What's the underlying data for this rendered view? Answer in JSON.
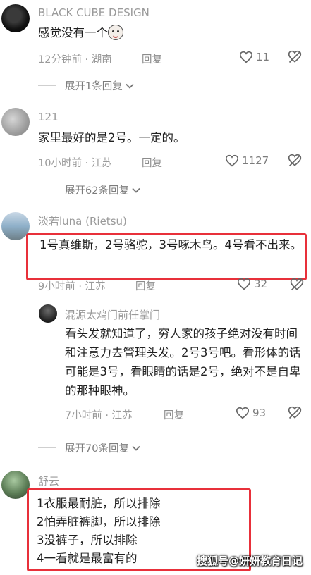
{
  "comments": [
    {
      "username": "BLACK CUBE DESIGN",
      "text": "感觉没有一个",
      "emoji_icon": "cat-face-icon",
      "meta": "12分钟前 · 湖南",
      "reply_label": "回复",
      "likes": "11",
      "expand": "展开1条回复"
    },
    {
      "username": "121",
      "text": "家里最好的是2号。一定的。",
      "meta": "10小时前 · 江苏",
      "reply_label": "回复",
      "likes": "1127",
      "expand": "展开62条回复"
    },
    {
      "username": "淡若luna (Rietsu)",
      "text": "1号真维斯，2号骆驼，3号啄木鸟。4号看不出来。",
      "meta": "9小时前 · 江苏",
      "reply_label": "回复",
      "likes": "32",
      "reply": {
        "username": "混源太鸡门前任掌门",
        "text": "看头发就知道了，穷人家的孩子绝对没有时间和注意力去管理头发。2号3号吧。看形体的话可能是3号，看眼睛的话是2号，绝对不是自卑的那种眼神。",
        "meta": "7小时前 · 江苏",
        "reply_label": "回复",
        "likes": "93"
      },
      "expand": "展开70条回复"
    },
    {
      "username": "舒云",
      "lines": [
        "1衣服最耐脏，所以排除",
        "2怕弄脏裤脚，所以排除",
        "3没裤子，所以排除",
        "4一看就是最富有的"
      ]
    }
  ],
  "watermark": "搜狐号@妍妍教育日记",
  "colors": {
    "highlight_box": "#e8303a",
    "muted_text": "#9a9a9a"
  }
}
